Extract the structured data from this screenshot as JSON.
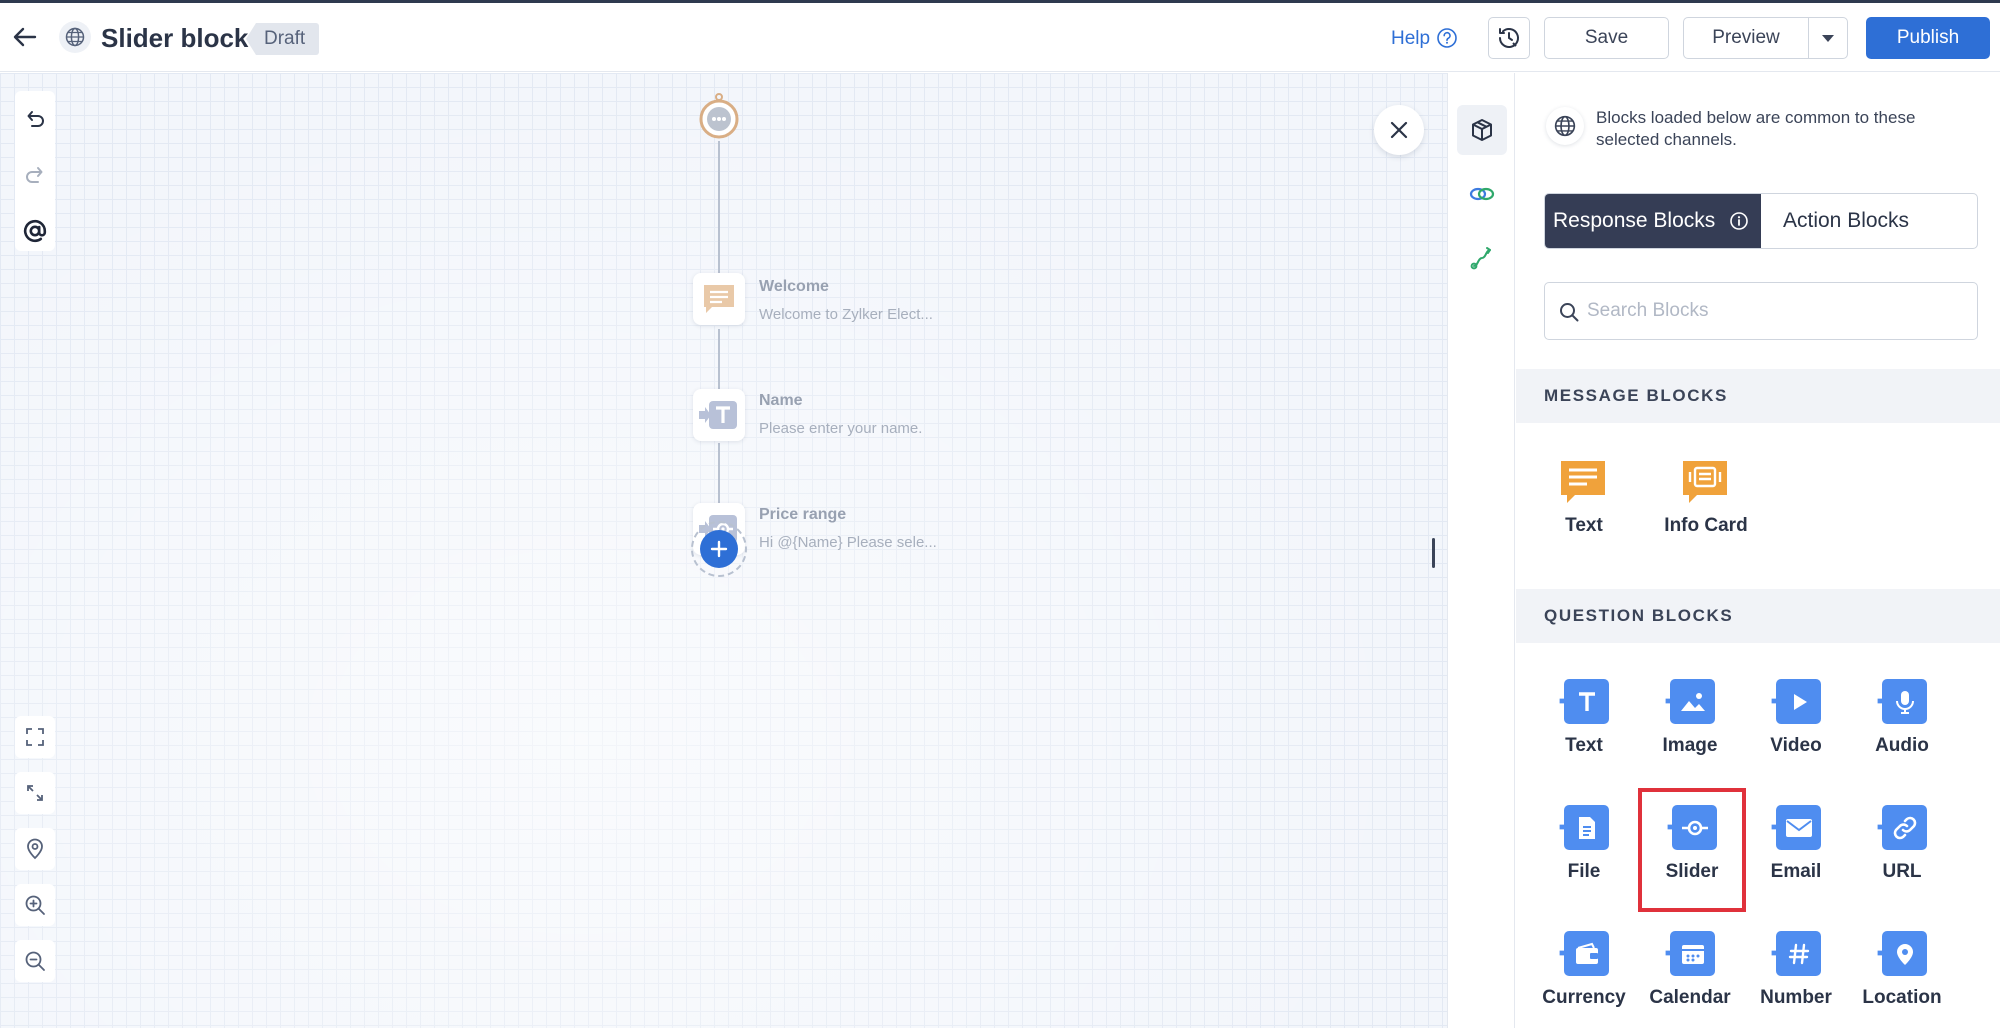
{
  "header": {
    "title": "Slider block",
    "status": "Draft",
    "help_label": "Help",
    "save_label": "Save",
    "preview_label": "Preview",
    "publish_label": "Publish"
  },
  "flow": {
    "nodes": [
      {
        "title": "Welcome",
        "subtitle": "Welcome to Zylker Elect..."
      },
      {
        "title": "Name",
        "subtitle": "Please enter your name."
      },
      {
        "title": "Price range",
        "subtitle": "Hi  @{Name}  Please sele..."
      }
    ]
  },
  "panel": {
    "channel_note": "Blocks loaded below are common to these selected channels.",
    "tabs": [
      "Response Blocks",
      "Action Blocks"
    ],
    "search_placeholder": "Search Blocks",
    "message_section": "MESSAGE BLOCKS",
    "message_blocks": [
      "Text",
      "Info Card"
    ],
    "question_section": "QUESTION BLOCKS",
    "question_blocks": [
      "Text",
      "Image",
      "Video",
      "Audio",
      "File",
      "Slider",
      "Email",
      "URL",
      "Currency",
      "Calendar",
      "Number",
      "Location"
    ]
  },
  "colors": {
    "accent": "#2e6fd6",
    "message_block_icon": "#f0a23b",
    "question_block_icon": "#4f8df0",
    "active_tab": "#353d55",
    "highlight": "#e0313b"
  }
}
